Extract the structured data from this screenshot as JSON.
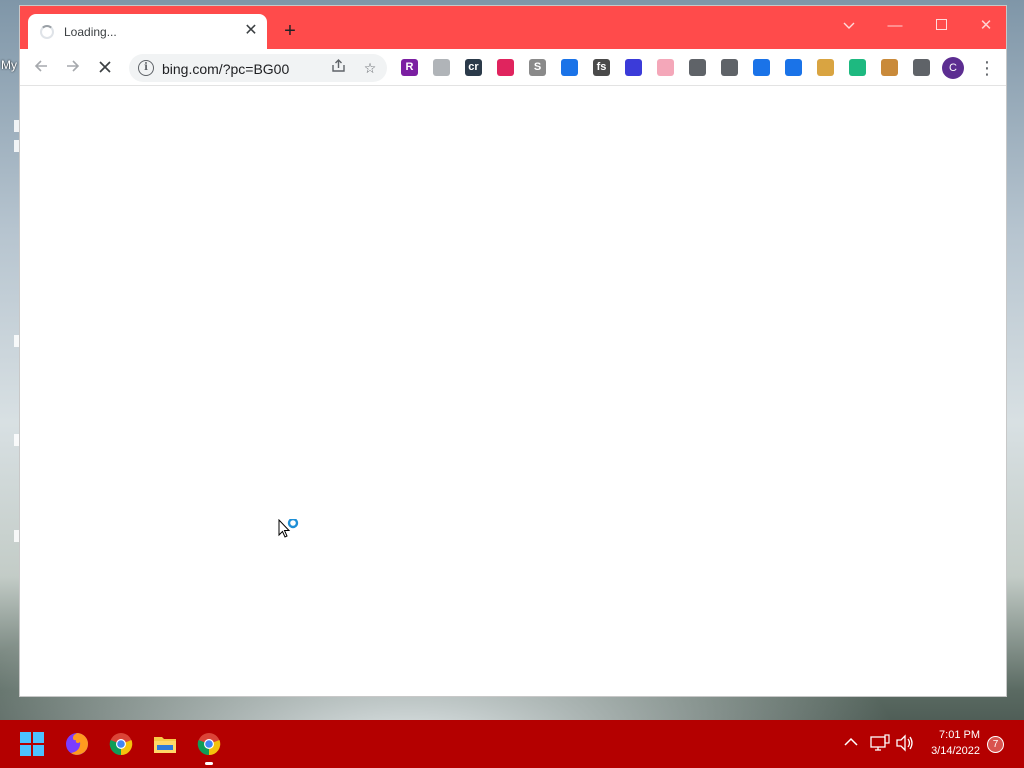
{
  "desktop": {
    "icon_label_partial": "My"
  },
  "browser": {
    "tab": {
      "title": "Loading..."
    },
    "address": {
      "url": "bing.com/?pc=BG00"
    },
    "profile_initial": "C",
    "extensions": [
      {
        "name": "r-extension-icon",
        "label": "R",
        "color": "#7b1fa2"
      },
      {
        "name": "elephant-extension-icon",
        "label": "",
        "color": "#b0b4b8"
      },
      {
        "name": "cr-extension-icon",
        "label": "cr",
        "color": "#2b3a4a"
      },
      {
        "name": "cursor-extension-icon",
        "label": "",
        "color": "#e0245e"
      },
      {
        "name": "s-extension-icon",
        "label": "S",
        "color": "#8a8a8a"
      },
      {
        "name": "puzzle-extension-icon",
        "label": "",
        "color": "#1a73e8"
      },
      {
        "name": "fs-extension-icon",
        "label": "fs",
        "color": "#4a4a4a"
      },
      {
        "name": "grid-extension-icon",
        "label": "",
        "color": "#3b3bd9"
      },
      {
        "name": "flag-extension-icon",
        "label": "",
        "color": "#f4a7b9"
      },
      {
        "name": "image-extension-icon",
        "label": "",
        "color": "#5f6368"
      },
      {
        "name": "dollar-extension-icon",
        "label": "",
        "color": "#5f6368"
      },
      {
        "name": "puzzle-extension-icon-2",
        "label": "",
        "color": "#1a73e8"
      },
      {
        "name": "puzzle-extension-icon-3",
        "label": "",
        "color": "#1a73e8"
      },
      {
        "name": "doge-extension-icon",
        "label": "",
        "color": "#d9a441"
      },
      {
        "name": "play-extension-icon",
        "label": "",
        "color": "#1eb980"
      },
      {
        "name": "monkey-extension-icon",
        "label": "",
        "color": "#c98a3a"
      },
      {
        "name": "extensions-menu-icon",
        "label": "",
        "color": "#5f6368"
      }
    ]
  },
  "taskbar": {
    "time": "7:01 PM",
    "date": "3/14/2022",
    "notification_count": "7"
  },
  "colors": {
    "titlebar": "#ff4b4b",
    "taskbar": "#b40000"
  }
}
